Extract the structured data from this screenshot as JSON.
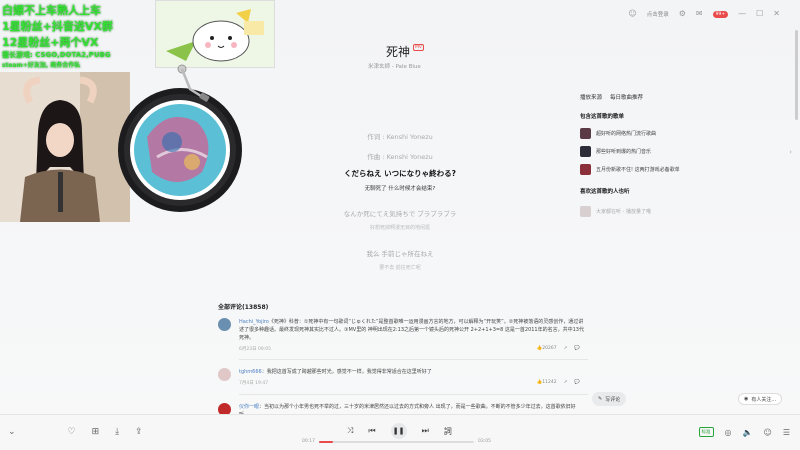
{
  "window": {
    "login_label": "点击登录",
    "badge": "99+",
    "icons": [
      "user-icon",
      "gear-icon",
      "mail-icon",
      "minimize-icon",
      "maximize-icon",
      "close-icon"
    ]
  },
  "overlay": {
    "line1": "白嫖不上车熟人上车",
    "line2": "1星粉丝+抖音进VX群",
    "line3": "12星粉丝+两个VX",
    "line4": "擅长游戏: CSGO,DOTA2,PUBG",
    "line5": "steam+好友加, 商务合作私"
  },
  "song": {
    "title": "死神",
    "mv_tag": "MV",
    "artist": "米津玄師 - Pale Blue"
  },
  "lyrics": [
    {
      "text": "作词 : Kenshi Yonezu",
      "kind": "dim"
    },
    {
      "text": "作曲 : Kenshi Yonezu",
      "kind": "dim"
    },
    {
      "text": "くだらねえ いつになりゃ終わる?",
      "kind": "active"
    },
    {
      "text": "无聊死了 什么时候才会结束?",
      "kind": "active-sub"
    },
    {
      "text": "なんか死にてえ気持ちで ブラブラブラ",
      "kind": "dim"
    },
    {
      "text": "好想死掉啊漫无目的地闲逛",
      "kind": "sub"
    },
    {
      "text": "我么 手前じゃ所在ねえ",
      "kind": "dim"
    },
    {
      "text": "要不去 前往死亡呢",
      "kind": "sub"
    }
  ],
  "right_panel": {
    "tabs": [
      "播放来源",
      "每日歌曲推荐"
    ],
    "playlist_title": "包含这首歌的歌单",
    "playlists": [
      {
        "name": "超好听的网络热门流行歌曲",
        "color": "#5a3b45"
      },
      {
        "name": "那些好听到爆的热门音乐",
        "color": "#2d2d3a"
      },
      {
        "name": "五月份新歌不住! 这两打游戏必备歌单",
        "color": "#8b2f3b"
      }
    ],
    "fans_title": "喜欢这首歌的人也听",
    "fans_item": "大家都在听 - 播放量了哦"
  },
  "comments": {
    "header": "全部评论(13858)",
    "items": [
      {
        "user": "Hachi_Yojiro",
        "text": "《死神》科普：①死神中有一句歌词“じゅくれた”是整首歌唯一运用漫画方言的地方，可以解释为“开玩笑”。②死神被落语的灵感创作，通过讲述了很多种趣话。最终发现死神其实比不过人。③MV里的 神明出现在2:13之后第一个镜头后的死神公开 2+2+1+3=8 这是一首2011年的名言，共中13代死神。",
        "time": "6月23日 09:05",
        "likes": "20267"
      },
      {
        "user": "tghm666",
        "text": "：我把这首写成了跨越那些时光，感觉不一样，我觉得非常适合在这里听好了",
        "time": "7月4日 19:47",
        "likes": "11242"
      },
      {
        "user": "仪你一眼",
        "text": "：当初以为那个小年男也死不举的过，三十岁的米津居然还以过去的方式和旁人 出现了，而是一些歌曲。不断的不管多少年过去，这首歌依旧好听。",
        "time": "",
        "likes": ""
      }
    ]
  },
  "buttons": {
    "write_comment": "写评论",
    "online_users": "有人关注..."
  },
  "player": {
    "elapsed": "00:17",
    "total": "03:05",
    "progress": 0.09,
    "quality": "标准"
  },
  "colors": {
    "accent": "#e94a4a",
    "overlay_text": "#35e035",
    "link": "#4a7fc1"
  }
}
